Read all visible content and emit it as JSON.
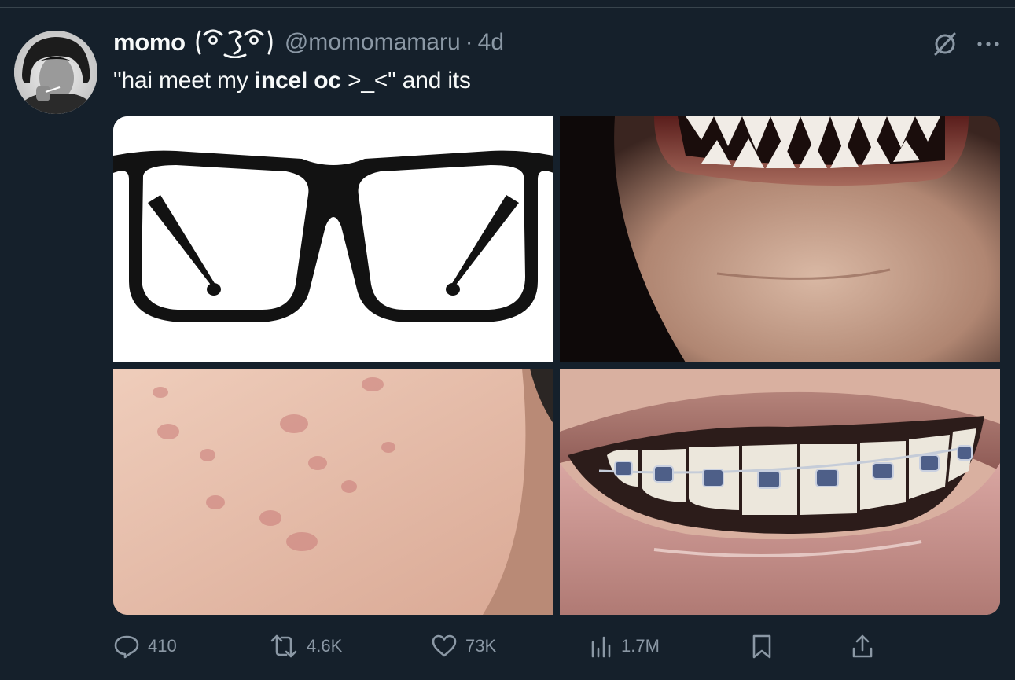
{
  "author": {
    "display_name": "momo",
    "kaomoji": "( ͡° ͜ʖ ͡°)",
    "handle": "@momomamaru",
    "separator": "·",
    "time": "4d"
  },
  "tweet": {
    "text_before": "\"hai meet my ",
    "text_bold": "incel oc",
    "text_after": " >_<\" and its"
  },
  "media": [
    {
      "name": "glasses-image"
    },
    {
      "name": "sharp-teeth-image"
    },
    {
      "name": "acne-skin-image"
    },
    {
      "name": "braces-image"
    }
  ],
  "actions": {
    "replies": "410",
    "reposts": "4.6K",
    "likes": "73K",
    "views": "1.7M"
  },
  "icons": {
    "reply": "reply-icon",
    "repost": "repost-icon",
    "like": "heart-icon",
    "views": "views-icon",
    "bookmark": "bookmark-icon",
    "share": "share-icon",
    "grok": "grok-icon",
    "more": "more-icon"
  },
  "colors": {
    "background": "#15202b",
    "text": "#f7f9f9",
    "secondary": "#8b98a5"
  }
}
